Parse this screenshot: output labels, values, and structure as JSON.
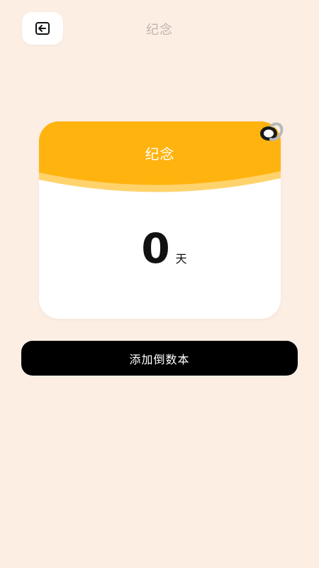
{
  "header": {
    "title": "纪念",
    "back_icon": "back-arrow-icon"
  },
  "card": {
    "title": "纪念",
    "count": "0",
    "unit": "天",
    "accent_color": "#FFB30F",
    "ring_icon": "binder-ring-icon"
  },
  "actions": {
    "add_label": "添加倒数本"
  },
  "colors": {
    "background": "#FDEEE4",
    "button": "#000000",
    "button_text": "#FFFFFF"
  }
}
